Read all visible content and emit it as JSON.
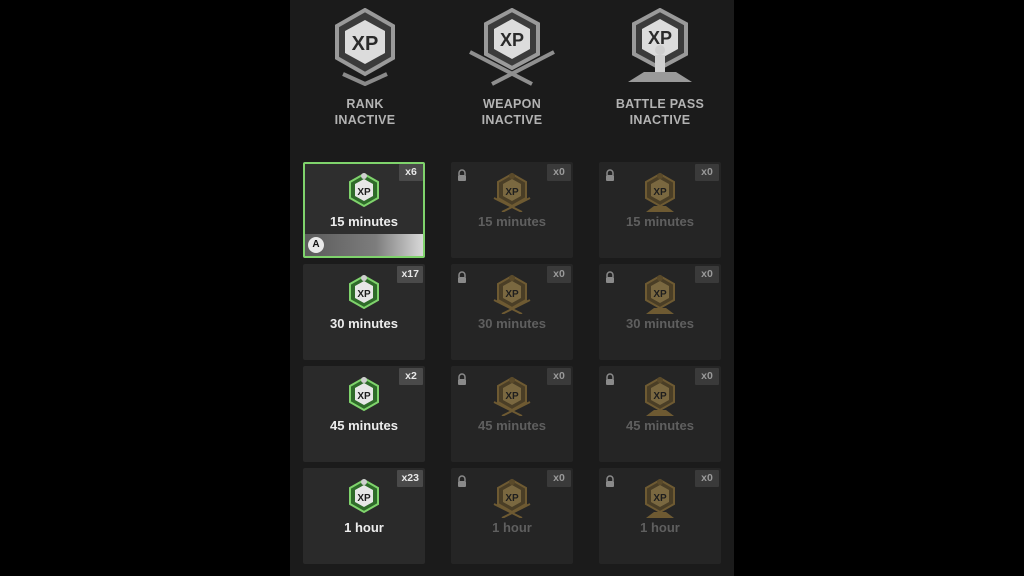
{
  "colors": {
    "accent_green": "#7fd36c",
    "icon_locked": "#6e5a32",
    "text_light": "#ededed",
    "text_dim": "#5f5f5f"
  },
  "headers": [
    {
      "icon": "rank-xp-icon",
      "line1": "RANK",
      "line2": "INACTIVE"
    },
    {
      "icon": "weapon-xp-icon",
      "line1": "WEAPON",
      "line2": "INACTIVE"
    },
    {
      "icon": "battle-pass-xp-icon",
      "line1": "BATTLE PASS",
      "line2": "INACTIVE"
    }
  ],
  "columns": [
    {
      "type": "rank",
      "locked": false,
      "tokens": [
        {
          "duration": "15 minutes",
          "count": "x6",
          "selected": true
        },
        {
          "duration": "30 minutes",
          "count": "x17"
        },
        {
          "duration": "45 minutes",
          "count": "x2"
        },
        {
          "duration": "1 hour",
          "count": "x23"
        }
      ]
    },
    {
      "type": "weapon",
      "locked": true,
      "tokens": [
        {
          "duration": "15 minutes",
          "count": "x0"
        },
        {
          "duration": "30 minutes",
          "count": "x0"
        },
        {
          "duration": "45 minutes",
          "count": "x0"
        },
        {
          "duration": "1 hour",
          "count": "x0"
        }
      ]
    },
    {
      "type": "battle-pass",
      "locked": true,
      "tokens": [
        {
          "duration": "15 minutes",
          "count": "x0"
        },
        {
          "duration": "30 minutes",
          "count": "x0"
        },
        {
          "duration": "45 minutes",
          "count": "x0"
        },
        {
          "duration": "1 hour",
          "count": "x0"
        }
      ]
    }
  ],
  "select_prompt": {
    "button": "A"
  }
}
